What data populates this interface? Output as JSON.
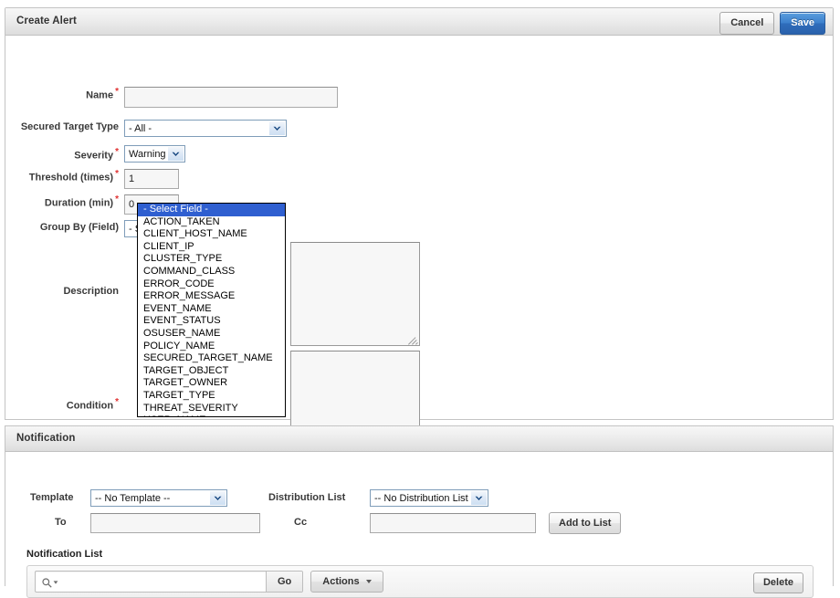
{
  "create_alert": {
    "title": "Create Alert",
    "cancel_label": "Cancel",
    "save_label": "Save",
    "fields": {
      "name": {
        "label": "Name",
        "value": "",
        "placeholder": ""
      },
      "secured_target_type": {
        "label": "Secured Target Type",
        "value": "- All -"
      },
      "severity": {
        "label": "Severity",
        "value": "Warning"
      },
      "threshold": {
        "label": "Threshold (times)",
        "value": "1"
      },
      "duration": {
        "label": "Duration (min)",
        "value": "0"
      },
      "group_by": {
        "label": "Group By (Field)",
        "value": "- Select Field -"
      },
      "description": {
        "label": "Description",
        "value": ""
      },
      "condition": {
        "label": "Condition",
        "value": ""
      }
    },
    "group_by_options": [
      "- Select Field -",
      "ACTION_TAKEN",
      "CLIENT_HOST_NAME",
      "CLIENT_IP",
      "CLUSTER_TYPE",
      "COMMAND_CLASS",
      "ERROR_CODE",
      "ERROR_MESSAGE",
      "EVENT_NAME",
      "EVENT_STATUS",
      "OSUSER_NAME",
      "POLICY_NAME",
      "SECURED_TARGET_NAME",
      "TARGET_OBJECT",
      "TARGET_OWNER",
      "TARGET_TYPE",
      "THREAT_SEVERITY",
      "USER_NAME"
    ],
    "group_by_selected_index": 0
  },
  "notification": {
    "title": "Notification",
    "template": {
      "label": "Template",
      "value": "-- No Template --"
    },
    "distribution_list": {
      "label": "Distribution List",
      "value": "-- No Distribution List --"
    },
    "to": {
      "label": "To",
      "value": ""
    },
    "cc": {
      "label": "Cc",
      "value": ""
    },
    "add_to_list_label": "Add to List",
    "list": {
      "title": "Notification List",
      "search_value": "",
      "search_placeholder": "",
      "go_label": "Go",
      "actions_label": "Actions",
      "delete_label": "Delete"
    }
  },
  "colors": {
    "accent": "#2f6dbb",
    "required": "#e03030",
    "highlight": "#2f5fd0",
    "region_border": "#c4c4c4"
  }
}
